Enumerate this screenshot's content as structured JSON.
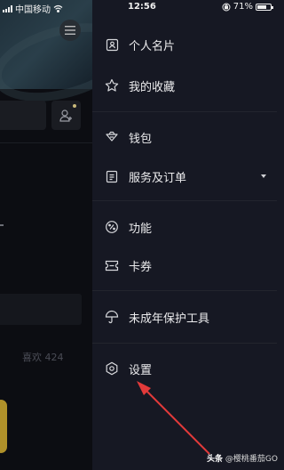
{
  "status_bar": {
    "carrier": "中国移动",
    "time": "12:56",
    "battery": "71%",
    "battery_level": 0.71
  },
  "profile_background": {
    "likes_text": "喜欢 424"
  },
  "drawer": {
    "items": [
      {
        "label": "个人名片",
        "icon": "id-card-icon"
      },
      {
        "label": "我的收藏",
        "icon": "star-icon"
      },
      {
        "label": "钱包",
        "icon": "wallet-icon"
      },
      {
        "label": "服务及订单",
        "icon": "order-list-icon",
        "expandable": true
      },
      {
        "label": "功能",
        "icon": "function-icon"
      },
      {
        "label": "卡券",
        "icon": "coupon-icon"
      },
      {
        "label": "未成年保护工具",
        "icon": "umbrella-icon"
      },
      {
        "label": "设置",
        "icon": "settings-icon"
      }
    ]
  },
  "watermark": {
    "brand": "头条",
    "handle": "@樱桃番茄GO"
  },
  "colors": {
    "drawer_bg": "#161823",
    "arrow": "#e23a3a"
  }
}
